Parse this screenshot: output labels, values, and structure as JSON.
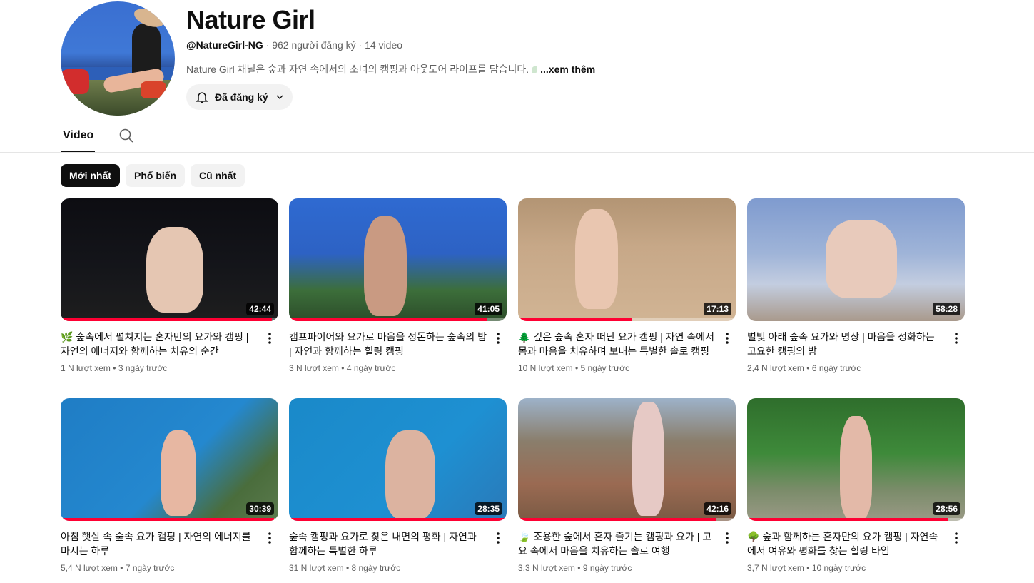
{
  "channel": {
    "name": "Nature Girl",
    "handle": "@NatureGirl-NG",
    "subscribers": "962 người đăng ký",
    "video_count": "14 video",
    "separator": " · ",
    "description": "Nature Girl 채널은 숲과 자연 속에서의 소녀의 캠핑과 아웃도어 라이프를 담습니다.",
    "more_label": "...xem thêm",
    "subscribe_label": "Đã đăng ký",
    "subscribe_icon": "bell-icon"
  },
  "tabs": {
    "video_label": "Video",
    "search_icon": "search-icon"
  },
  "chips": [
    {
      "label": "Mới nhất",
      "active": true
    },
    {
      "label": "Phổ biến",
      "active": false
    },
    {
      "label": "Cũ nhất",
      "active": false
    }
  ],
  "videos": [
    {
      "title": "🌿 숲속에서 펼쳐지는 혼자만의 요가와 캠핑 | 자연의 에너지와 함께하는 치유의 순간",
      "views": "1 N lượt xem",
      "age": "3 ngày trước",
      "duration": "42:44",
      "watched": 0.97
    },
    {
      "title": "캠프파이어와 요가로 마음을 정돈하는 숲속의 밤 | 자연과 함께하는 힐링 캠핑",
      "views": "3 N lượt xem",
      "age": "4 ngày trước",
      "duration": "41:05",
      "watched": 0.91
    },
    {
      "title": "🌲 깊은 숲속 혼자 떠난 요가 캠핑 | 자연 속에서 몸과 마음을 치유하며 보내는 특별한 솔로 캠핑",
      "views": "10 N lượt xem",
      "age": "5 ngày trước",
      "duration": "17:13",
      "watched": 0.52
    },
    {
      "title": "별빛 아래 숲속 요가와 명상 | 마음을 정화하는 고요한 캠핑의 밤",
      "views": "2,4 N lượt xem",
      "age": "6 ngày trước",
      "duration": "58:28",
      "watched": 0
    },
    {
      "title": "아침 햇살 속 숲속 요가 캠핑 | 자연의 에너지를 마시는 하루",
      "views": "5,4 N lượt xem",
      "age": "7 ngày trước",
      "duration": "30:39",
      "watched": 0.98
    },
    {
      "title": "숲속 캠핑과 요가로 찾은 내면의 평화 | 자연과 함께하는 특별한 하루",
      "views": "31 N lượt xem",
      "age": "8 ngày trước",
      "duration": "28:35",
      "watched": 1.0
    },
    {
      "title": "🍃 조용한 숲에서 혼자 즐기는 캠핑과 요가 | 고요 속에서 마음을 치유하는 솔로 여행",
      "views": "3,3 N lượt xem",
      "age": "9 ngày trước",
      "duration": "42:16",
      "watched": 0.91
    },
    {
      "title": "🌳 숲과 함께하는 혼자만의 요가 캠핑 | 자연속에서 여유와 평화를 찾는 힐링 타임",
      "views": "3,7 N lượt xem",
      "age": "10 ngày trước",
      "duration": "28:56",
      "watched": 0.92
    }
  ],
  "colors": {
    "accent": "#ff0033",
    "text_primary": "#0f0f0f",
    "text_secondary": "#606060",
    "chip_bg": "#f2f2f2"
  }
}
